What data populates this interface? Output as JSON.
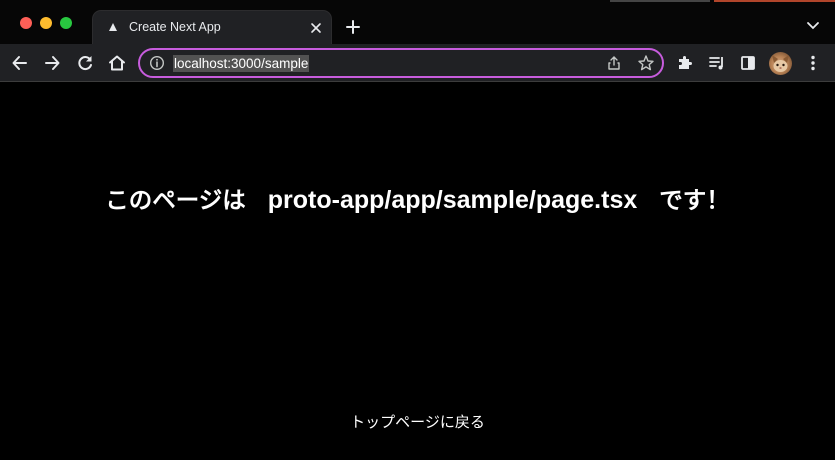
{
  "tab": {
    "title": "Create Next App",
    "favicon": "triangle-icon"
  },
  "toolbar": {
    "url": "localhost:3000/sample",
    "icons": [
      "back-icon",
      "forward-icon",
      "reload-icon",
      "home-icon",
      "info-icon",
      "share-icon",
      "star-icon",
      "extensions-icon",
      "media-icon",
      "side-panel-icon",
      "profile-avatar",
      "menu-icon"
    ]
  },
  "page": {
    "heading_prefix": "このページは",
    "heading_path": "proto-app/app/sample/page.tsx",
    "heading_suffix": "です！",
    "back_link": "トップページに戻る"
  },
  "colors": {
    "omnibox_focus": "#c75cdd",
    "background": "#000000",
    "text": "#ffffff"
  }
}
